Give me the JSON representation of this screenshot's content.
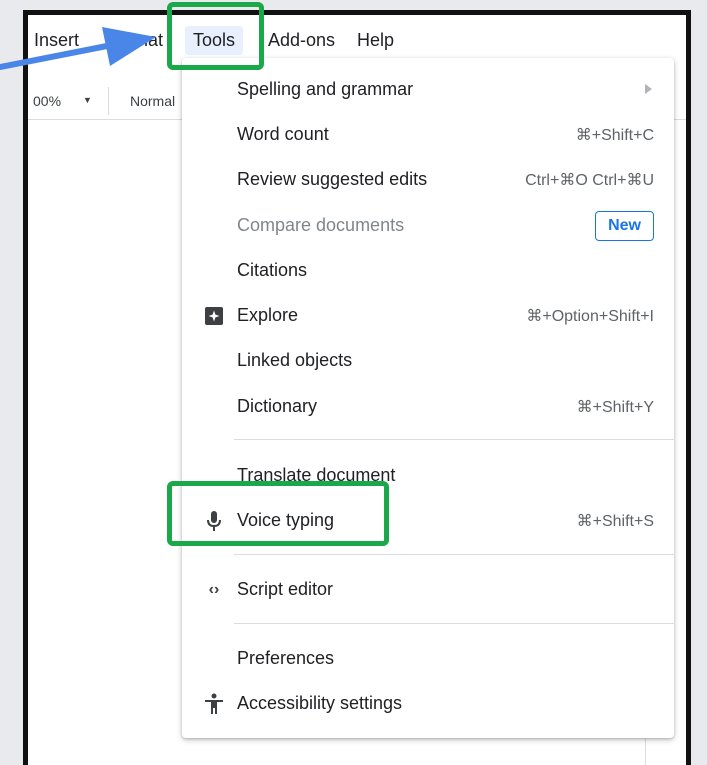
{
  "menubar": {
    "items": [
      {
        "label": "Insert"
      },
      {
        "label": "Format"
      },
      {
        "label": "Tools"
      },
      {
        "label": "Add-ons"
      },
      {
        "label": "Help"
      }
    ]
  },
  "toolbar": {
    "zoom": "00%",
    "style": "Normal"
  },
  "tools_menu": {
    "items": [
      {
        "label": "Spelling and grammar",
        "shortcut": ""
      },
      {
        "label": "Word count",
        "shortcut": "⌘+Shift+C"
      },
      {
        "label": "Review suggested edits",
        "shortcut": "Ctrl+⌘O Ctrl+⌘U"
      },
      {
        "label": "Compare documents",
        "badge": "New"
      },
      {
        "label": "Citations",
        "shortcut": ""
      },
      {
        "label": "Explore",
        "shortcut": "⌘+Option+Shift+I"
      },
      {
        "label": "Linked objects",
        "shortcut": ""
      },
      {
        "label": "Dictionary",
        "shortcut": "⌘+Shift+Y"
      },
      {
        "label": "Translate document",
        "shortcut": ""
      },
      {
        "label": "Voice typing",
        "shortcut": "⌘+Shift+S"
      },
      {
        "label": "Script editor",
        "shortcut": ""
      },
      {
        "label": "Preferences",
        "shortcut": ""
      },
      {
        "label": "Accessibility settings",
        "shortcut": ""
      }
    ]
  },
  "colors": {
    "highlight": "#1aa84a",
    "arrow": "#4a86e8",
    "new_badge": "#1a73e8"
  }
}
